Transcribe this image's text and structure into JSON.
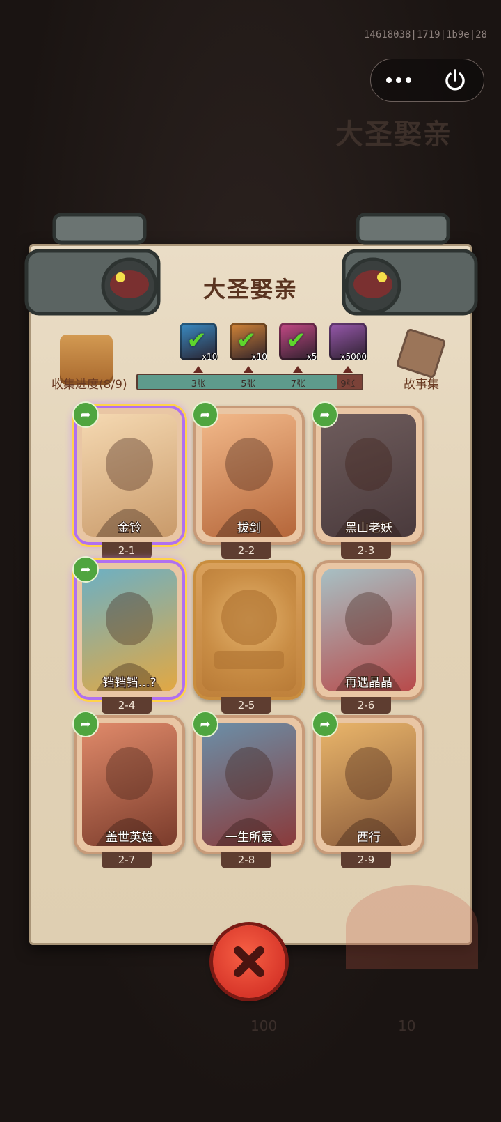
{
  "debug_id": "14618038|1719|1b9e|28",
  "background": {
    "title": "大圣娶亲",
    "bottom_left_value": "100",
    "bottom_right_value": "10"
  },
  "capsule": {
    "more_icon": "more-dots-icon",
    "power_icon": "power-icon"
  },
  "panel": {
    "title": "大圣娶亲",
    "progress_label": "收集进度(8/9)",
    "story_label": "故事集",
    "progress": {
      "collected": 8,
      "total": 9
    },
    "milestones": [
      {
        "label": "3张",
        "at": 3
      },
      {
        "label": "5张",
        "at": 5
      },
      {
        "label": "7张",
        "at": 7
      },
      {
        "label": "9张",
        "at": 9
      }
    ],
    "rewards": [
      {
        "qty": "x10",
        "claimed": true,
        "color": "#3a8fc9"
      },
      {
        "qty": "x10",
        "claimed": true,
        "color": "#d88838"
      },
      {
        "qty": "x5",
        "claimed": true,
        "color": "#c84a88"
      },
      {
        "qty": "x5000",
        "claimed": false,
        "color": "#9a5ab0"
      }
    ]
  },
  "cards": [
    {
      "name": "金铃",
      "num": "2-1",
      "holo": true,
      "locked": false,
      "share": true,
      "colors": [
        "#f5d9b2",
        "#c99a6a"
      ]
    },
    {
      "name": "拔剑",
      "num": "2-2",
      "holo": false,
      "locked": false,
      "share": true,
      "colors": [
        "#f2b98a",
        "#b5663a"
      ]
    },
    {
      "name": "黑山老妖",
      "num": "2-3",
      "holo": false,
      "locked": false,
      "share": true,
      "colors": [
        "#6e5c5c",
        "#4a3a3c"
      ]
    },
    {
      "name": "铛铛铛…?",
      "num": "2-4",
      "holo": true,
      "locked": false,
      "share": true,
      "colors": [
        "#6cb0c4",
        "#e2a843"
      ]
    },
    {
      "name": "",
      "num": "2-5",
      "holo": false,
      "locked": true,
      "share": false,
      "colors": [
        "#d9a05b",
        "#c0823c"
      ]
    },
    {
      "name": "再遇晶晶",
      "num": "2-6",
      "holo": false,
      "locked": false,
      "share": false,
      "colors": [
        "#a7c0c4",
        "#b84a4a"
      ]
    },
    {
      "name": "盖世英雄",
      "num": "2-7",
      "holo": false,
      "locked": false,
      "share": true,
      "colors": [
        "#e08a6a",
        "#7a3b2b"
      ]
    },
    {
      "name": "一生所爱",
      "num": "2-8",
      "holo": false,
      "locked": false,
      "share": true,
      "colors": [
        "#6b8fa8",
        "#8a3a3a"
      ]
    },
    {
      "name": "西行",
      "num": "2-9",
      "holo": false,
      "locked": false,
      "share": true,
      "colors": [
        "#e9b56a",
        "#8a5a3a"
      ]
    }
  ],
  "close_icon": "close-x-icon"
}
